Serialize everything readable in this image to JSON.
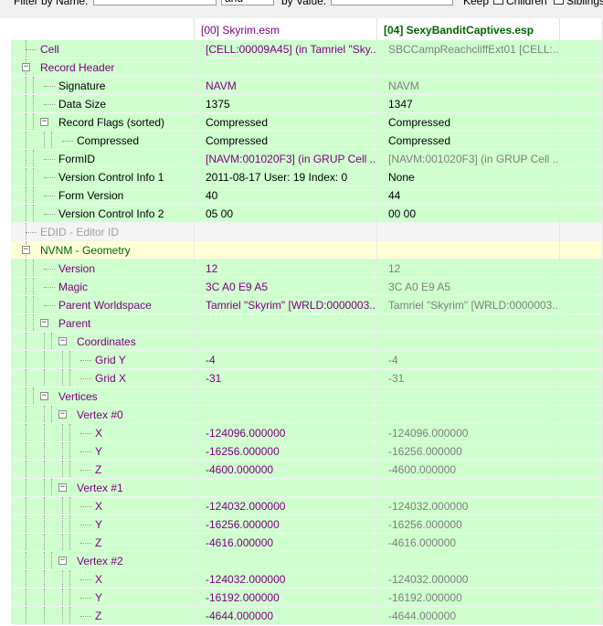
{
  "filter_bar": {
    "filter_by_name_label": "Filter by Name:",
    "operator_value": "and",
    "filter_by_value_label": "by Value:",
    "keep_label": "Keep",
    "children_label": "Children",
    "siblings_label": "Siblings"
  },
  "columns": {
    "file1": "[00] Skyrim.esm",
    "file2": "[04] SexyBanditCaptives.esp"
  },
  "rows": [
    {
      "label": "Cell",
      "v1": "[CELL:00009A45] (in Tamriel \"Sky...",
      "v2": "SBCCampReachcliffExt01 [CELL:..."
    },
    {
      "label": "Record Header",
      "v1": "",
      "v2": ""
    },
    {
      "label": "Signature",
      "v1": "NAVM",
      "v2": "NAVM"
    },
    {
      "label": "Data Size",
      "v1": "1375",
      "v2": "1347"
    },
    {
      "label": "Record Flags (sorted)",
      "v1": "Compressed",
      "v2": "Compressed"
    },
    {
      "label": "Compressed",
      "v1": "Compressed",
      "v2": "Compressed"
    },
    {
      "label": "FormID",
      "v1": "[NAVM:001020F3] (in GRUP Cell ...",
      "v2": "[NAVM:001020F3] (in GRUP Cell ..."
    },
    {
      "label": "Version Control Info 1",
      "v1": "2011-08-17 User: 19 Index: 0",
      "v2": "None"
    },
    {
      "label": "Form Version",
      "v1": "40",
      "v2": "44"
    },
    {
      "label": "Version Control Info 2",
      "v1": "05 00",
      "v2": "00 00"
    },
    {
      "label": "EDID - Editor ID",
      "v1": "",
      "v2": ""
    },
    {
      "label": "NVNM - Geometry",
      "v1": "",
      "v2": ""
    },
    {
      "label": "Version",
      "v1": "12",
      "v2": "12"
    },
    {
      "label": "Magic",
      "v1": "3C A0 E9 A5",
      "v2": "3C A0 E9 A5"
    },
    {
      "label": "Parent Worldspace",
      "v1": "Tamriel \"Skyrim\" [WRLD:0000003...",
      "v2": "Tamriel \"Skyrim\" [WRLD:0000003..."
    },
    {
      "label": "Parent",
      "v1": "",
      "v2": ""
    },
    {
      "label": "Coordinates",
      "v1": "",
      "v2": ""
    },
    {
      "label": "Grid Y",
      "v1": "-4",
      "v2": "-4"
    },
    {
      "label": "Grid X",
      "v1": "-31",
      "v2": "-31"
    },
    {
      "label": "Vertices",
      "v1": "",
      "v2": ""
    },
    {
      "label": "Vertex #0",
      "v1": "",
      "v2": ""
    },
    {
      "label": "X",
      "v1": "-124096.000000",
      "v2": "-124096.000000"
    },
    {
      "label": "Y",
      "v1": "-16256.000000",
      "v2": "-16256.000000"
    },
    {
      "label": "Z",
      "v1": "-4600.000000",
      "v2": "-4600.000000"
    },
    {
      "label": "Vertex #1",
      "v1": "",
      "v2": ""
    },
    {
      "label": "X",
      "v1": "-124032.000000",
      "v2": "-124032.000000"
    },
    {
      "label": "Y",
      "v1": "-16256.000000",
      "v2": "-16256.000000"
    },
    {
      "label": "Z",
      "v1": "-4616.000000",
      "v2": "-4616.000000"
    },
    {
      "label": "Vertex #2",
      "v1": "",
      "v2": ""
    },
    {
      "label": "X",
      "v1": "-124032.000000",
      "v2": "-124032.000000"
    },
    {
      "label": "Y",
      "v1": "-16192.000000",
      "v2": "-16192.000000"
    },
    {
      "label": "Z",
      "v1": "-4644.000000",
      "v2": "-4644.000000"
    }
  ],
  "colors": {
    "row_green": "#cfffcf",
    "row_gray": "#f4f4f4",
    "row_yellow": "#ffffd6",
    "label_purple": "#800080",
    "label_green": "#006400",
    "value_gray": "#7f7f7f"
  }
}
